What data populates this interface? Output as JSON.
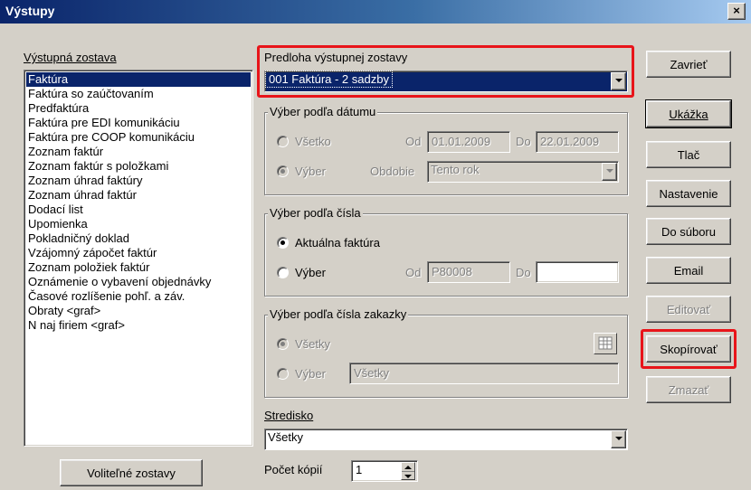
{
  "window": {
    "title": "Výstupy",
    "close_label": "×"
  },
  "left_panel": {
    "heading": "Výstupná zostava",
    "items": [
      "Faktúra",
      "Faktúra so zaúčtovaním",
      "Predfaktúra",
      "Faktúra pre EDI komunikáciu",
      "Faktúra pre COOP komunikáciu",
      "Zoznam faktúr",
      "Zoznam faktúr s položkami",
      "Zoznam úhrad faktúry",
      "Zoznam úhrad faktúr",
      "Dodací list",
      "Upomienka",
      "Pokladničný doklad",
      "Vzájomný zápočet faktúr",
      "Zoznam položiek faktúr",
      "Oznámenie o vybavení objednávky",
      "Časové rozlíšenie pohľ. a záv.",
      "Obraty <graf>",
      "N naj firiem  <graf>"
    ],
    "selected_index": 0,
    "optional_button": "Voliteľné zostavy"
  },
  "template": {
    "label": "Predloha výstupnej zostavy",
    "value": "001 Faktúra - 2 sadzby"
  },
  "by_date": {
    "title": "Výber podľa dátumu",
    "all_label": "Všetko",
    "select_label": "Výber",
    "from_label": "Od",
    "from_value": "01.01.2009",
    "to_label": "Do",
    "to_value": "22.01.2009",
    "period_label": "Obdobie",
    "period_value": "Tento rok"
  },
  "by_number": {
    "title": "Výber podľa čísla",
    "current_label": "Aktuálna faktúra",
    "select_label": "Výber",
    "from_label": "Od",
    "from_value": "P80008",
    "to_label": "Do",
    "to_value": ""
  },
  "by_order": {
    "title": "Výber podľa čísla zakazky",
    "all_label": "Všetky",
    "select_label": "Výber",
    "select_value": "Všetky"
  },
  "center": {
    "label": "Stredisko",
    "value": "Všetky"
  },
  "copies": {
    "label": "Počet kópií",
    "value": "1"
  },
  "buttons": {
    "close": "Zavrieť",
    "preview": "Ukážka",
    "print": "Tlač",
    "settings": "Nastavenie",
    "to_file": "Do súboru",
    "email": "Email",
    "edit": "Editovať",
    "copy": "Skopírovať",
    "delete": "Zmazať"
  },
  "colors": {
    "selection": "#0a246a",
    "highlight": "#e8141a",
    "face": "#d4d0c8"
  }
}
